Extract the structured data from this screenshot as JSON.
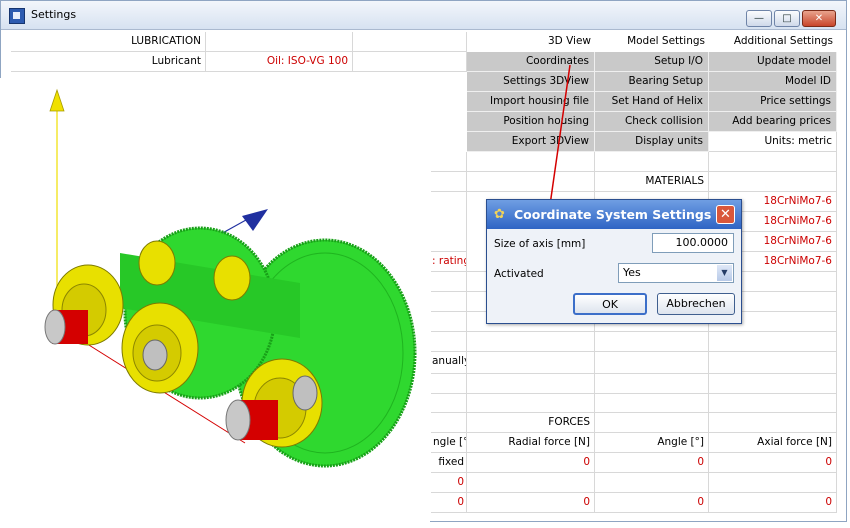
{
  "window": {
    "title": "Settings",
    "min_label": "—",
    "max_label": "□",
    "close_label": "✕"
  },
  "lubrication": {
    "header": "LUBRICATION",
    "lubricant_label": "Lubricant",
    "lubricant_value": "Oil: ISO-VG 100"
  },
  "buttons": {
    "view3d": "3D View",
    "model_settings": "Model Settings",
    "additional_settings": "Additional Settings",
    "coordinates": "Coordinates",
    "setup_io": "Setup I/O",
    "update_model": "Update model",
    "settings_3dview": "Settings 3DView",
    "bearing_setup": "Bearing Setup",
    "model_id": "Model ID",
    "import_housing": "Import housing file",
    "set_hand_helix": "Set Hand of Helix",
    "price_settings": "Price settings",
    "position_housing": "Position housing",
    "check_collision": "Check collision",
    "add_bearing_prices": "Add bearing prices",
    "export_3dview": "Export 3DView",
    "display_units": "Display units",
    "units_metric": "Units: metric"
  },
  "materials": {
    "header": "MATERIALS",
    "values": [
      "18CrNiMo7-6",
      "18CrNiMo7-6",
      "18CrNiMo7-6",
      "18CrNiMo7-6"
    ]
  },
  "left_texts": {
    "rating": ": rating",
    "manually": "anually"
  },
  "forces": {
    "header": "FORCES",
    "columns": [
      "ngle [°]",
      "Radial force [N]",
      "Angle [°]",
      "Axial force [N]"
    ],
    "rows": [
      [
        "fixed",
        "0",
        "0",
        "0"
      ],
      [
        "0",
        "",
        "",
        ""
      ],
      [
        "0",
        "0",
        "0",
        "0"
      ]
    ]
  },
  "dialog": {
    "title": "Coordinate System Settings",
    "close_label": "✕",
    "size_label": "Size of axis [mm]",
    "size_value": "100.0000",
    "activated_label": "Activated",
    "activated_value": "Yes",
    "ok_label": "OK",
    "cancel_label": "Abbrechen"
  },
  "colors": {
    "gear": "#2fd82f",
    "bearing": "#e8e000",
    "shaft": "#d40000",
    "axis_y": "#f0e000",
    "axis_z": "#2030a0",
    "axis_x": "#d40000",
    "accent_red": "#cc0000",
    "button_gray": "#c9c9c9"
  },
  "icons": {
    "app": "settings-app-icon",
    "dialog": "gears-icon",
    "select": "chevron-down-icon"
  }
}
